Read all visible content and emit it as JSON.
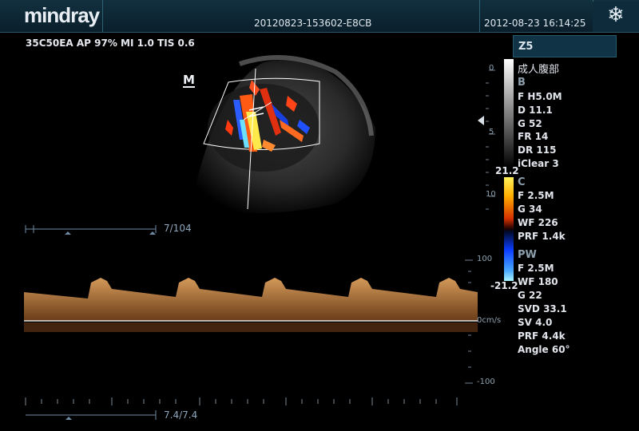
{
  "header": {
    "logo": "mindray",
    "patient_id": "20120823-153602-E8CB",
    "datetime": "2012-08-23  16:14:25",
    "freeze_icon": "snowflake-icon"
  },
  "imaging_params": "35C50EA  AP 97%  MI 1.0  TIS 0.6",
  "mode_tag": "Z5",
  "exam_preset": "成人腹部",
  "b_mode": {
    "title": "B",
    "lines": [
      "F H5.0M",
      "D 11.1",
      "G 52",
      "FR 14",
      "DR 115",
      "iClear 3"
    ]
  },
  "color_scale": {
    "max": "21.2",
    "min": "-21.2"
  },
  "color_mode": {
    "title": "C",
    "lines": [
      "F 2.5M",
      "G 34",
      "WF 226",
      "PRF 1.4k"
    ]
  },
  "pw_mode": {
    "title": "PW",
    "lines": [
      "F 2.5M",
      "WF 180",
      "G 22",
      "SVD 33.1",
      "SV 4.0",
      "PRF 4.4k",
      "Angle 60°"
    ]
  },
  "depth_ticks": [
    "0",
    "5",
    "10"
  ],
  "pw_scale": {
    "top": "100",
    "baseline": "0cm/s",
    "bottom": "-100"
  },
  "cine_bar_top": {
    "label": "7/104"
  },
  "cine_bar_bottom": {
    "label": "7.4/7.4"
  },
  "body_marker": "M",
  "colors": {
    "header_bg": "#0a1f2b",
    "accent": "#2f6275"
  }
}
